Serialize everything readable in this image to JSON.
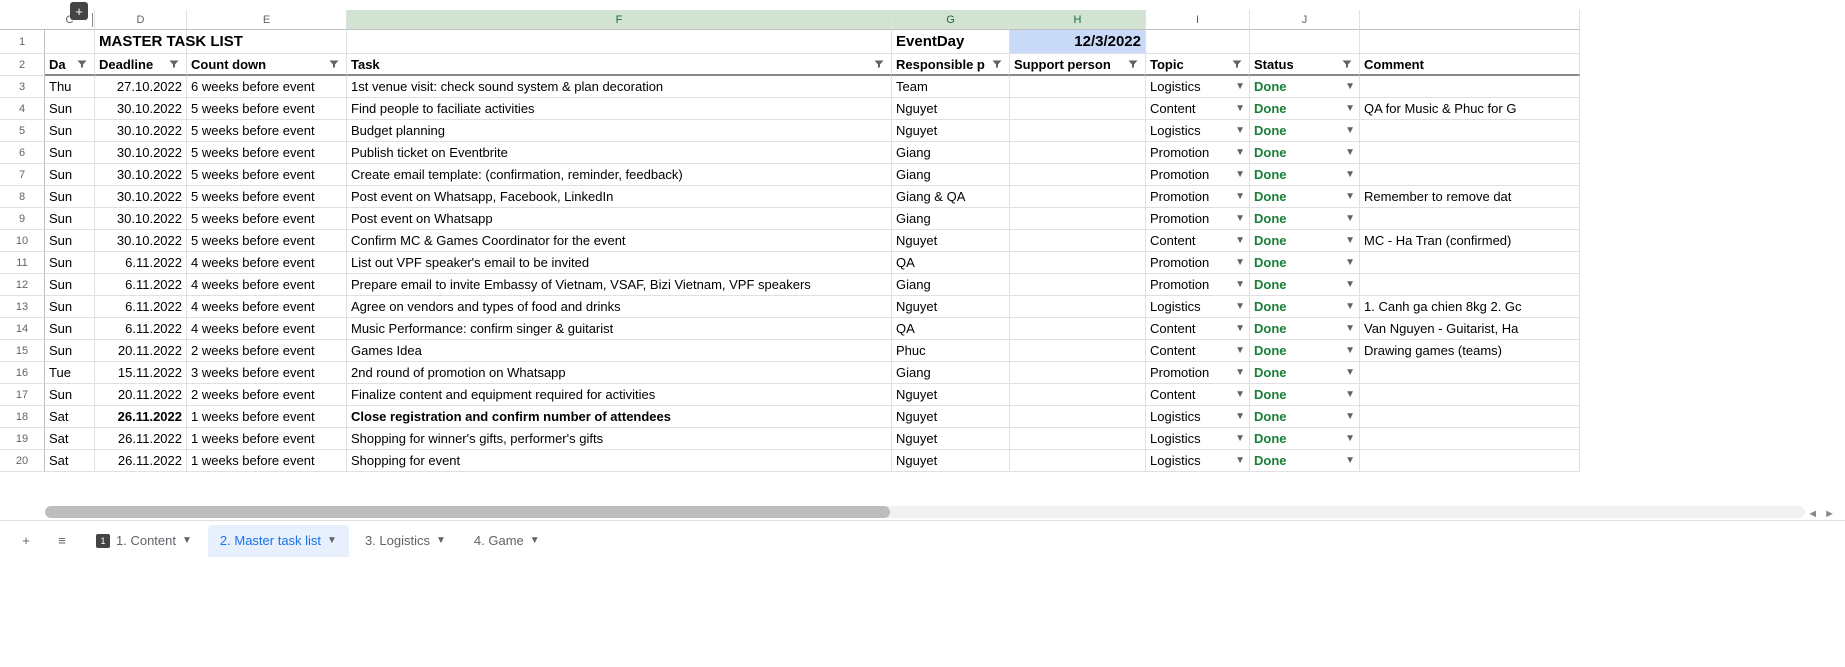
{
  "title_cell": "MASTER TASK LIST",
  "eventday_label": "EventDay",
  "eventday_value": "12/3/2022",
  "columns": {
    "letters": [
      "C",
      "D",
      "E",
      "F",
      "G",
      "H",
      "I",
      "J"
    ],
    "headers": {
      "c": "Da",
      "d": "Deadline",
      "e": "Count down",
      "f": "Task",
      "g": "Responsible p",
      "h": "Support person",
      "i": "Topic",
      "j": "Status",
      "k": "Comment"
    }
  },
  "row_numbers": [
    1,
    2,
    3,
    4,
    5,
    6,
    7,
    8,
    9,
    10,
    11,
    12,
    13,
    14,
    15,
    16,
    17,
    18,
    19,
    20
  ],
  "rows": [
    {
      "day": "Thu",
      "deadline": "27.10.2022",
      "countdown": "6 weeks before event",
      "task": "1st venue visit: check sound system & plan decoration",
      "responsible": "Team",
      "support": "",
      "topic": "Logistics",
      "status": "Done",
      "comment": ""
    },
    {
      "day": "Sun",
      "deadline": "30.10.2022",
      "countdown": "5 weeks before event",
      "task": "Find people to faciliate activities",
      "responsible": "Nguyet",
      "support": "",
      "topic": "Content",
      "status": "Done",
      "comment": "QA for Music & Phuc for G"
    },
    {
      "day": "Sun",
      "deadline": "30.10.2022",
      "countdown": "5 weeks before event",
      "task": "Budget planning",
      "responsible": "Nguyet",
      "support": "",
      "topic": "Logistics",
      "status": "Done",
      "comment": ""
    },
    {
      "day": "Sun",
      "deadline": "30.10.2022",
      "countdown": "5 weeks before event",
      "task": "Publish ticket on Eventbrite",
      "responsible": "Giang",
      "support": "",
      "topic": "Promotion",
      "status": "Done",
      "comment": ""
    },
    {
      "day": "Sun",
      "deadline": "30.10.2022",
      "countdown": "5 weeks before event",
      "task": "Create email template: (confirmation, reminder, feedback)",
      "responsible": "Giang",
      "support": "",
      "topic": "Promotion",
      "status": "Done",
      "comment": ""
    },
    {
      "day": "Sun",
      "deadline": "30.10.2022",
      "countdown": "5 weeks before event",
      "task": "Post event on Whatsapp, Facebook, LinkedIn",
      "responsible": "Giang & QA",
      "support": "",
      "topic": "Promotion",
      "status": "Done",
      "comment": "Remember to remove dat"
    },
    {
      "day": "Sun",
      "deadline": "30.10.2022",
      "countdown": "5 weeks before event",
      "task": "Post event on Whatsapp",
      "responsible": "Giang",
      "support": "",
      "topic": "Promotion",
      "status": "Done",
      "comment": ""
    },
    {
      "day": "Sun",
      "deadline": "30.10.2022",
      "countdown": "5 weeks before event",
      "task": "Confirm MC & Games Coordinator for the event",
      "responsible": "Nguyet",
      "support": "",
      "topic": "Content",
      "status": "Done",
      "comment": "MC - Ha Tran (confirmed)"
    },
    {
      "day": "Sun",
      "deadline": "6.11.2022",
      "countdown": "4 weeks before event",
      "task": "List out VPF speaker's email to be invited",
      "responsible": "QA",
      "support": "",
      "topic": "Promotion",
      "status": "Done",
      "comment": ""
    },
    {
      "day": "Sun",
      "deadline": "6.11.2022",
      "countdown": "4 weeks before event",
      "task": "Prepare email to invite Embassy of Vietnam, VSAF, Bizi Vietnam, VPF speakers",
      "responsible": "Giang",
      "support": "",
      "topic": "Promotion",
      "status": "Done",
      "comment": ""
    },
    {
      "day": "Sun",
      "deadline": "6.11.2022",
      "countdown": "4 weeks before event",
      "task": "Agree on vendors and types of food and drinks",
      "responsible": "Nguyet",
      "support": "",
      "topic": "Logistics",
      "status": "Done",
      "comment": "1. Canh ga chien 8kg 2. Gc"
    },
    {
      "day": "Sun",
      "deadline": "6.11.2022",
      "countdown": "4 weeks before event",
      "task": "Music Performance: confirm singer & guitarist",
      "responsible": "QA",
      "support": "",
      "topic": "Content",
      "status": "Done",
      "comment": "Van Nguyen - Guitarist, Ha"
    },
    {
      "day": "Sun",
      "deadline": "20.11.2022",
      "countdown": "2 weeks before event",
      "task": "Games Idea",
      "responsible": "Phuc",
      "support": "",
      "topic": "Content",
      "status": "Done",
      "comment": "Drawing games (teams)"
    },
    {
      "day": "Tue",
      "deadline": "15.11.2022",
      "countdown": "3 weeks before event",
      "task": "2nd round of promotion on Whatsapp",
      "responsible": "Giang",
      "support": "",
      "topic": "Promotion",
      "status": "Done",
      "comment": ""
    },
    {
      "day": "Sun",
      "deadline": "20.11.2022",
      "countdown": "2 weeks before event",
      "task": "Finalize content and equipment required for activities",
      "responsible": "Nguyet",
      "support": "",
      "topic": "Content",
      "status": "Done",
      "comment": ""
    },
    {
      "day": "Sat",
      "deadline": "26.11.2022",
      "countdown": "1 weeks before event",
      "task": "Close registration and confirm number of attendees",
      "responsible": "Nguyet",
      "support": "",
      "topic": "Logistics",
      "status": "Done",
      "comment": "",
      "bold": true
    },
    {
      "day": "Sat",
      "deadline": "26.11.2022",
      "countdown": "1 weeks before event",
      "task": "Shopping for winner's gifts, performer's gifts",
      "responsible": "Nguyet",
      "support": "",
      "topic": "Logistics",
      "status": "Done",
      "comment": ""
    },
    {
      "day": "Sat",
      "deadline": "26.11.2022",
      "countdown": "1 weeks before event",
      "task": "Shopping for event",
      "responsible": "Nguyet",
      "support": "",
      "topic": "Logistics",
      "status": "Done",
      "comment": ""
    }
  ],
  "tabs": [
    {
      "num": "1",
      "label": "1. Content",
      "active": false
    },
    {
      "num": "",
      "label": "2. Master task list",
      "active": true
    },
    {
      "num": "",
      "label": "3. Logistics",
      "active": false
    },
    {
      "num": "",
      "label": "4. Game",
      "active": false
    }
  ]
}
